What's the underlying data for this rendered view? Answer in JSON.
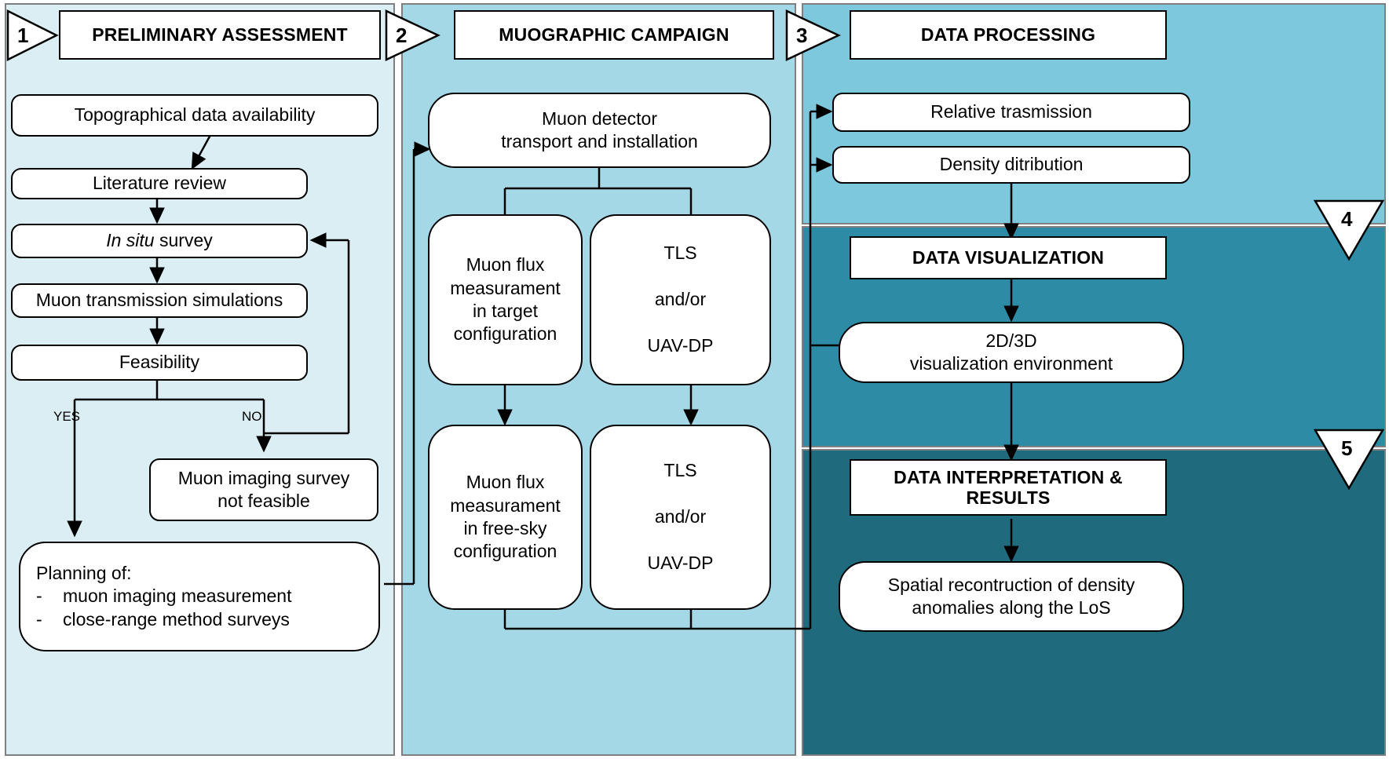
{
  "diagram": {
    "title": "Muography workflow flowchart",
    "stages": [
      {
        "number": "1",
        "title": "PRELIMINARY ASSESSMENT",
        "color": "#daeef3",
        "nodes": [
          "Topographical data availability",
          "Literature review",
          "In situ survey",
          "Muon transmission simulations",
          "Feasibility",
          "Muon imaging survey not feasible",
          "Planning of:"
        ]
      },
      {
        "number": "2",
        "title": "MUOGRAPHIC CAMPAIGN",
        "color": "#a5d8e6",
        "nodes": [
          "Muon detector transport and installation",
          "Muon flux measurament in target configuration",
          "TLS and/or UAV-DP",
          "Muon flux measurament in free-sky configuration",
          "TLS and/or UAV-DP"
        ]
      },
      {
        "number": "3",
        "title": "DATA PROCESSING",
        "color": "#7ec8dd",
        "nodes": [
          "Relative trasmission",
          "Density ditribution"
        ]
      },
      {
        "number": "4",
        "title": "DATA VISUALIZATION",
        "color": "#2e8ba6",
        "nodes": [
          "2D/3D visualization environment"
        ]
      },
      {
        "number": "5",
        "title": "DATA INTERPRETATION & RESULTS",
        "color": "#1f6b7d",
        "nodes": [
          "Spatial recontruction of density anomalies along the LoS"
        ]
      }
    ]
  },
  "stage1": {
    "marker": "1",
    "header": "PRELIMINARY ASSESSMENT",
    "topographical": "Topographical data availability",
    "literature": "Literature review",
    "insitu_italic": "In situ",
    "insitu_rest": " survey",
    "simulations": "Muon transmission simulations",
    "feasibility": "Feasibility",
    "yes_label": "YES",
    "no_label": "NO",
    "not_feasible_l1": "Muon imaging survey",
    "not_feasible_l2": "not feasible",
    "planning_title": "Planning of:",
    "planning_dash": "-",
    "planning_item1": "muon imaging measurement",
    "planning_item2": "close-range method surveys"
  },
  "stage2": {
    "marker": "2",
    "header": "MUOGRAPHIC CAMPAIGN",
    "detector_l1": "Muon detector",
    "detector_l2": "transport and installation",
    "flux_target_l1": "Muon flux",
    "flux_target_l2": "measurament",
    "flux_target_l3": "in target",
    "flux_target_l4": "configuration",
    "tls_top_l1": "TLS",
    "tls_top_l2": "and/or",
    "tls_top_l3": "UAV-DP",
    "flux_free_l1": "Muon flux",
    "flux_free_l2": "measurament",
    "flux_free_l3": "in free-sky",
    "flux_free_l4": "configuration",
    "tls_bottom_l1": "TLS",
    "tls_bottom_l2": "and/or",
    "tls_bottom_l3": "UAV-DP"
  },
  "stage3": {
    "marker": "3",
    "header": "DATA PROCESSING",
    "transmission": "Relative trasmission",
    "density": "Density ditribution"
  },
  "stage4": {
    "marker": "4",
    "header": "DATA VISUALIZATION",
    "viz_l1": "2D/3D",
    "viz_l2": "visualization environment"
  },
  "stage5": {
    "marker": "5",
    "header_l1": "DATA INTERPRETATION &",
    "header_l2": "RESULTS",
    "result_l1": "Spatial recontruction of density",
    "result_l2": "anomalies along the LoS"
  },
  "colors": {
    "panel1": "#daeef3",
    "panel2": "#a5d8e6",
    "panel3": "#7ec8dd",
    "panel4": "#2e8ba6",
    "panel5": "#1f6b7d",
    "stroke": "#000000",
    "panel_border": "#7f7f7f",
    "box_fill": "#ffffff"
  }
}
